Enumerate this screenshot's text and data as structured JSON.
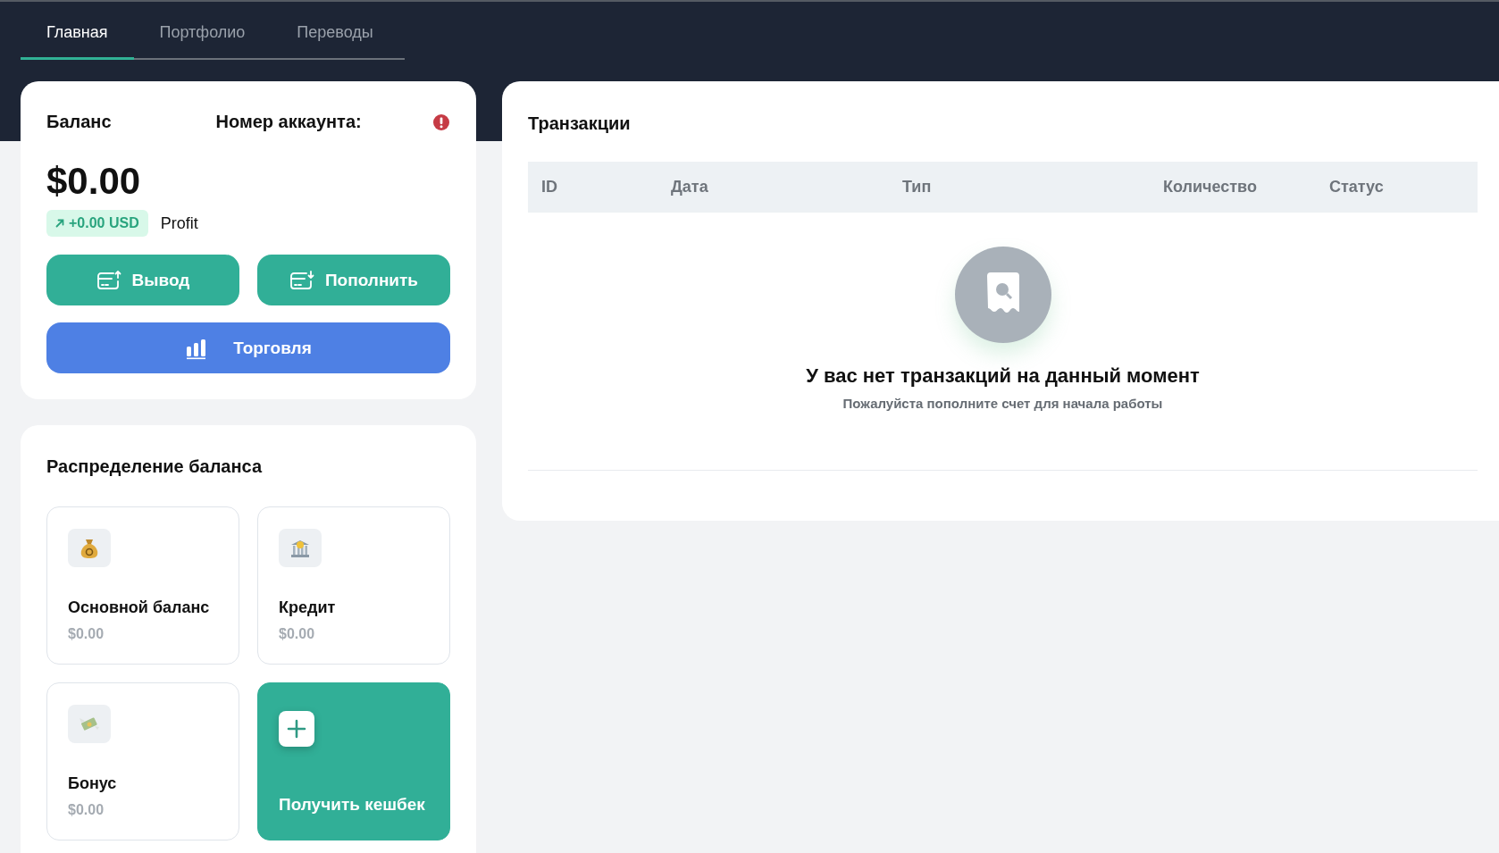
{
  "tabs": [
    {
      "label": "Главная",
      "selected": true
    },
    {
      "label": "Портфолио",
      "selected": false
    },
    {
      "label": "Переводы",
      "selected": false
    }
  ],
  "balance_card": {
    "title": "Баланс",
    "account_label": "Номер аккаунта:",
    "amount": "$0.00",
    "change": "+0.00 USD",
    "change_label": "Profit",
    "buttons": [
      {
        "kind": "withdraw",
        "label": "Вывод"
      },
      {
        "kind": "deposit",
        "label": "Пополнить"
      },
      {
        "kind": "trade",
        "label": "Торговля"
      }
    ]
  },
  "distribution": {
    "title": "Распределение баланса",
    "tiles": [
      {
        "kind": "balance",
        "name": "Основной баланс",
        "value": "$0.00"
      },
      {
        "kind": "balance",
        "name": "Кредит",
        "value": "$0.00"
      },
      {
        "kind": "balance",
        "name": "Бонус",
        "value": "$0.00"
      },
      {
        "kind": "action",
        "name": "Получить кешбек"
      }
    ]
  },
  "transactions": {
    "title": "Транзакции",
    "columns": [
      "ID",
      "Дата",
      "Тип",
      "Количество",
      "Статус"
    ],
    "empty_title": "У вас нет транзакций на данный момент",
    "empty_subtitle": "Пожалуйста пополните счет для начала работы"
  }
}
